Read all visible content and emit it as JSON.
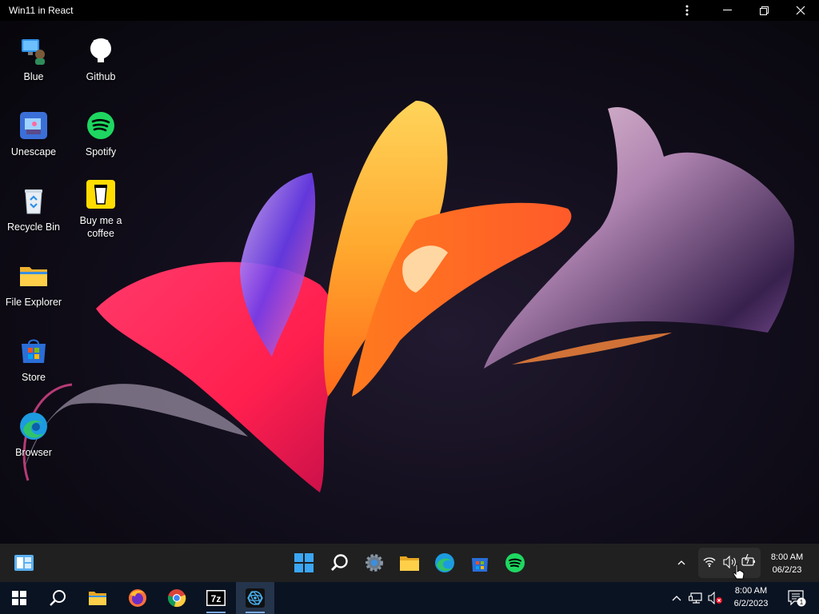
{
  "window": {
    "title": "Win11 in React"
  },
  "desktop_icons": [
    {
      "label": "Blue"
    },
    {
      "label": "Github"
    },
    {
      "label": "Unescape"
    },
    {
      "label": "Spotify"
    },
    {
      "label": "Recycle Bin"
    },
    {
      "label": "Buy me a coffee"
    },
    {
      "label": "File Explorer"
    },
    {
      "label": "Store"
    },
    {
      "label": "Browser"
    }
  ],
  "inner_taskbar": {
    "apps": [
      "widgets-icon",
      "windows-start-icon",
      "search-icon",
      "settings-icon",
      "file-explorer-icon",
      "edge-icon",
      "store-icon",
      "spotify-icon"
    ],
    "tray": [
      "chevron-up-icon",
      "wifi-icon",
      "volume-icon",
      "battery-icon"
    ],
    "clock": {
      "time": "8:00 AM",
      "date": "06/2/23"
    }
  },
  "host_taskbar": {
    "apps": [
      "windows-start-icon",
      "search-icon",
      "file-explorer-icon",
      "firefox-icon",
      "chrome-icon",
      "7zip-icon",
      "win11-react-icon"
    ],
    "tray": [
      "chevron-up-icon",
      "network-icon",
      "volume-muted-icon"
    ],
    "clock": {
      "time": "8:00 AM",
      "date": "6/2/2023"
    },
    "notifications": {
      "count": "1"
    }
  },
  "colors": {
    "desktop_bg": "#0d0b14",
    "taskbar": "#202020",
    "host_taskbar": "#0a1322",
    "accent": "#3b8eea"
  }
}
